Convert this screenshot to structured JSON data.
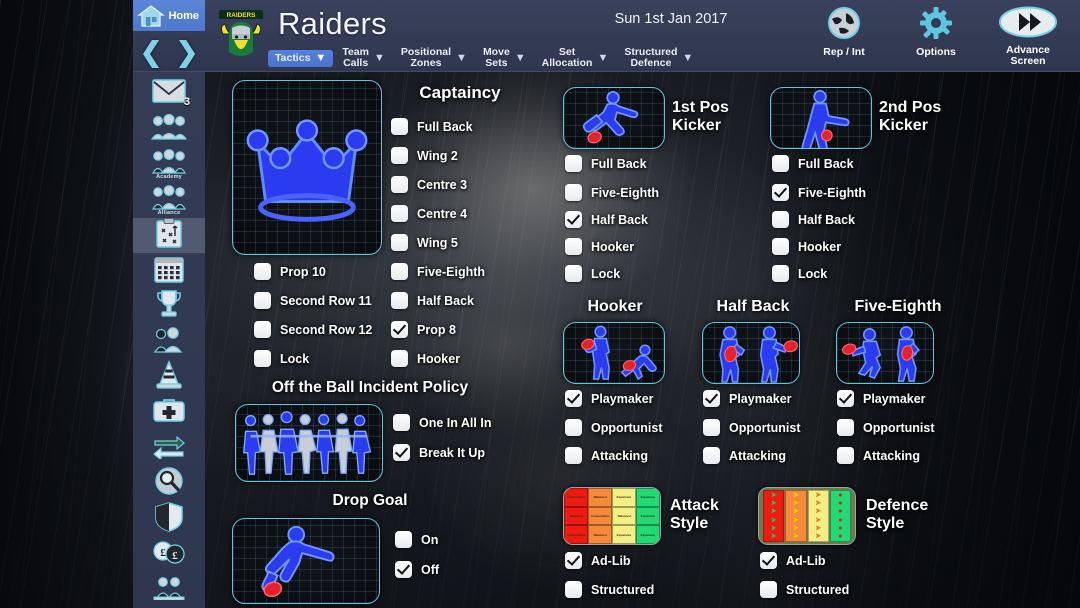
{
  "header": {
    "home_label": "Home",
    "home_icon": "home-icon",
    "prev_icon": "chevron-left-icon",
    "next_icon": "chevron-right-icon",
    "club_logo": "canberra-raiders-logo",
    "team_title": "Raiders",
    "date": "Sun 1st Jan 2017",
    "menu": [
      {
        "label": "Tactics",
        "active": true
      },
      {
        "label": "Team\nCalls",
        "active": false
      },
      {
        "label": "Positional\nZones",
        "active": false
      },
      {
        "label": "Move\nSets",
        "active": false
      },
      {
        "label": "Set\nAllocation",
        "active": false
      },
      {
        "label": "Structured\nDefence",
        "active": false
      }
    ],
    "buttons": [
      {
        "label": "Rep / Int",
        "icon": "globe-icon"
      },
      {
        "label": "Options",
        "icon": "gear-icon"
      },
      {
        "label": "Advance\nScreen",
        "icon": "fast-forward-icon"
      }
    ]
  },
  "sidebar": {
    "items": [
      {
        "icon": "mail-icon",
        "badge": "3",
        "selected": false
      },
      {
        "icon": "squad-icon",
        "sub": "",
        "selected": false
      },
      {
        "icon": "academy-icon",
        "sub": "Academy",
        "selected": false
      },
      {
        "icon": "alliance-icon",
        "sub": "Alliance",
        "selected": false
      },
      {
        "icon": "tactics-clipboard-icon",
        "sub": "",
        "selected": true
      },
      {
        "icon": "calendar-icon",
        "sub": "",
        "selected": false
      },
      {
        "icon": "trophy-icon",
        "sub": "",
        "selected": false
      },
      {
        "icon": "player-profile-icon",
        "sub": "",
        "selected": false
      },
      {
        "icon": "training-cone-icon",
        "sub": "",
        "selected": false
      },
      {
        "icon": "medical-kit-icon",
        "sub": "",
        "selected": false
      },
      {
        "icon": "transfers-icon",
        "sub": "",
        "selected": false
      },
      {
        "icon": "scout-search-icon",
        "sub": "",
        "selected": false
      },
      {
        "icon": "shield-icon",
        "sub": "",
        "selected": false
      },
      {
        "icon": "finances-icon",
        "sub": "",
        "selected": false
      },
      {
        "icon": "staff-icon",
        "sub": "",
        "selected": false
      }
    ]
  },
  "captaincy": {
    "title": "Captaincy",
    "thumb_icon": "crown-icon",
    "right_options": [
      {
        "label": "Full Back",
        "checked": false
      },
      {
        "label": "Wing 2",
        "checked": false
      },
      {
        "label": "Centre 3",
        "checked": false
      },
      {
        "label": "Centre 4",
        "checked": false
      },
      {
        "label": "Wing 5",
        "checked": false
      },
      {
        "label": "Five-Eighth",
        "checked": false
      },
      {
        "label": "Half Back",
        "checked": false
      },
      {
        "label": "Prop 8",
        "checked": true
      },
      {
        "label": "Hooker",
        "checked": false
      }
    ],
    "left_options": [
      {
        "label": "Prop 10",
        "checked": false
      },
      {
        "label": "Second Row 11",
        "checked": false
      },
      {
        "label": "Second Row 12",
        "checked": false
      },
      {
        "label": "Lock",
        "checked": false
      }
    ]
  },
  "off_ball": {
    "title": "Off the Ball Incident Policy",
    "thumb_icon": "brawl-players-icon",
    "options": [
      {
        "label": "One In All In",
        "checked": false
      },
      {
        "label": "Break It Up",
        "checked": true
      }
    ]
  },
  "drop_goal": {
    "title": "Drop Goal",
    "thumb_icon": "drop-goal-kicker-icon",
    "options": [
      {
        "label": "On",
        "checked": false
      },
      {
        "label": "Off",
        "checked": true
      }
    ]
  },
  "kicker1": {
    "title": "1st Pos\nKicker",
    "thumb_icon": "place-kicker-icon",
    "options": [
      {
        "label": "Full Back",
        "checked": false
      },
      {
        "label": "Five-Eighth",
        "checked": false
      },
      {
        "label": "Half Back",
        "checked": true
      },
      {
        "label": "Hooker",
        "checked": false
      },
      {
        "label": "Lock",
        "checked": false
      }
    ]
  },
  "kicker2": {
    "title": "2nd Pos\nKicker",
    "thumb_icon": "standing-kicker-icon",
    "options": [
      {
        "label": "Full Back",
        "checked": false
      },
      {
        "label": "Five-Eighth",
        "checked": true
      },
      {
        "label": "Half Back",
        "checked": false
      },
      {
        "label": "Hooker",
        "checked": false
      },
      {
        "label": "Lock",
        "checked": false
      }
    ]
  },
  "hooker": {
    "title": "Hooker",
    "thumb_icon": "hooker-dummy-half-icon",
    "options": [
      {
        "label": "Playmaker",
        "checked": true
      },
      {
        "label": "Opportunist",
        "checked": false
      },
      {
        "label": "Attacking",
        "checked": false
      }
    ]
  },
  "halfback": {
    "title": "Half Back",
    "thumb_icon": "half-back-pass-icon",
    "options": [
      {
        "label": "Playmaker",
        "checked": true
      },
      {
        "label": "Opportunist",
        "checked": false
      },
      {
        "label": "Attacking",
        "checked": false
      }
    ]
  },
  "fiveeighth": {
    "title": "Five-Eighth",
    "thumb_icon": "five-eighth-pass-icon",
    "options": [
      {
        "label": "Playmaker",
        "checked": true
      },
      {
        "label": "Opportunist",
        "checked": false
      },
      {
        "label": "Attacking",
        "checked": false
      }
    ]
  },
  "attack_style": {
    "title": "Attack\nStyle",
    "thumb_icon": "attack-style-grid-icon",
    "grid": [
      [
        {
          "text": "Conservative",
          "color": "#ee1c10"
        },
        {
          "text": "Balanced",
          "color": "#f58a3c"
        },
        {
          "text": "Expansive",
          "color": "#f3ef85"
        },
        {
          "text": "Expansive",
          "color": "#22d974"
        }
      ],
      [
        {
          "text": "Balanced",
          "color": "#ee1c10"
        },
        {
          "text": "Conservative",
          "color": "#f58a3c"
        },
        {
          "text": "Balanced",
          "color": "#f3ef85"
        },
        {
          "text": "Expansive",
          "color": "#22d974"
        }
      ],
      [
        {
          "text": "Conservative",
          "color": "#ee1c10"
        },
        {
          "text": "Balanced",
          "color": "#f58a3c"
        },
        {
          "text": "Expansive",
          "color": "#f3ef85"
        },
        {
          "text": "Expansive",
          "color": "#22d974"
        }
      ]
    ],
    "options": [
      {
        "label": "Ad-Lib",
        "checked": true
      },
      {
        "label": "Structured",
        "checked": false
      }
    ]
  },
  "defence_style": {
    "title": "Defence\nStyle",
    "thumb_icon": "defence-style-grid-icon",
    "columns": [
      {
        "color": "#ee1c10",
        "mark": "➡",
        "mark_color": "#22c55e",
        "count": 6
      },
      {
        "color": "#f58a3c",
        "mark": "➡",
        "mark_color": "#f7d400",
        "count": 6
      },
      {
        "color": "#f3ef85",
        "mark": "↗",
        "mark_color": "#e0791a",
        "count": 6
      },
      {
        "color": "#22d974",
        "mark": "●",
        "mark_color": "#d81f12",
        "count": 6
      }
    ],
    "options": [
      {
        "label": "Ad-Lib",
        "checked": true
      },
      {
        "label": "Structured",
        "checked": false
      }
    ]
  }
}
